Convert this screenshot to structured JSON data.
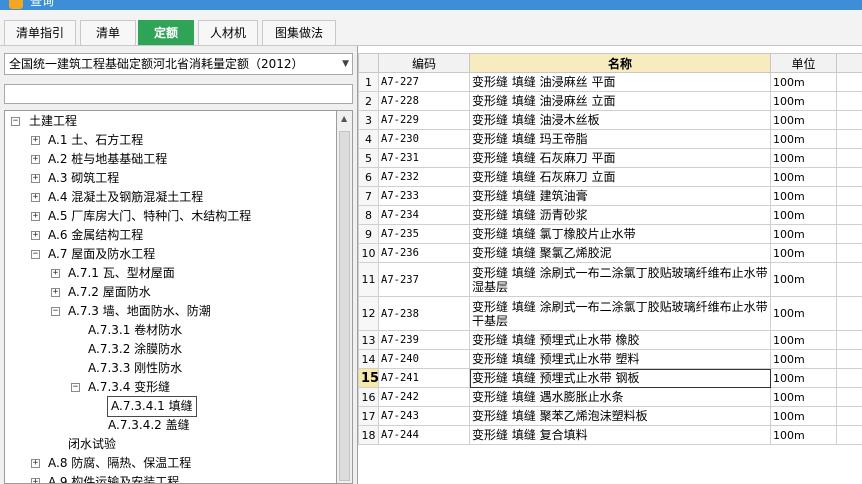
{
  "window": {
    "title": "查询"
  },
  "tabs": [
    {
      "label": "清单指引"
    },
    {
      "label": "清单"
    },
    {
      "label": "定额",
      "active": true
    },
    {
      "label": "人材机"
    },
    {
      "label": "图集做法"
    }
  ],
  "left": {
    "quota_library": "全国统一建筑工程基础定额河北省消耗量定额（2012）",
    "search_value": "",
    "tree": [
      {
        "label": "土建工程",
        "expand": "−"
      },
      {
        "label": "A.1 土、石方工程",
        "expand": "+"
      },
      {
        "label": "A.2 桩与地基基础工程",
        "expand": "+"
      },
      {
        "label": "A.3 砌筑工程",
        "expand": "+"
      },
      {
        "label": "A.4 混凝土及钢筋混凝土工程",
        "expand": "+"
      },
      {
        "label": "A.5 厂库房大门、特种门、木结构工程",
        "expand": "+"
      },
      {
        "label": "A.6 金属结构工程",
        "expand": "+"
      },
      {
        "label": "A.7 屋面及防水工程",
        "expand": "−"
      },
      {
        "label": "A.7.1 瓦、型材屋面",
        "expand": "+"
      },
      {
        "label": "A.7.2 屋面防水",
        "expand": "+"
      },
      {
        "label": "A.7.3 墙、地面防水、防潮",
        "expand": "−"
      },
      {
        "label": "A.7.3.1 卷材防水"
      },
      {
        "label": "A.7.3.2 涂膜防水"
      },
      {
        "label": "A.7.3.3 刚性防水"
      },
      {
        "label": "A.7.3.4 变形缝",
        "expand": "−"
      },
      {
        "label": "A.7.3.4.1 填缝",
        "selected": true
      },
      {
        "label": "A.7.3.4.2 盖缝"
      },
      {
        "label": "闭水试验"
      },
      {
        "label": "A.8 防腐、隔热、保温工程",
        "expand": "+"
      },
      {
        "label": "A.9 构件运输及安装工程",
        "expand": "+"
      }
    ]
  },
  "grid": {
    "columns": {
      "index": "",
      "code": "编码",
      "name": "名称",
      "unit": "单位"
    },
    "rows": [
      {
        "index": "1",
        "code": "A7-227",
        "name": "变形缝 填缝 油浸麻丝 平面",
        "unit": "100m"
      },
      {
        "index": "2",
        "code": "A7-228",
        "name": "变形缝 填缝 油浸麻丝 立面",
        "unit": "100m"
      },
      {
        "index": "3",
        "code": "A7-229",
        "name": "变形缝 填缝 油浸木丝板",
        "unit": "100m"
      },
      {
        "index": "4",
        "code": "A7-230",
        "name": "变形缝 填缝 玛王帝脂",
        "unit": "100m"
      },
      {
        "index": "5",
        "code": "A7-231",
        "name": "变形缝 填缝 石灰麻刀 平面",
        "unit": "100m"
      },
      {
        "index": "6",
        "code": "A7-232",
        "name": "变形缝 填缝 石灰麻刀 立面",
        "unit": "100m"
      },
      {
        "index": "7",
        "code": "A7-233",
        "name": "变形缝 填缝 建筑油膏",
        "unit": "100m"
      },
      {
        "index": "8",
        "code": "A7-234",
        "name": "变形缝 填缝 沥青砂浆",
        "unit": "100m"
      },
      {
        "index": "9",
        "code": "A7-235",
        "name": "变形缝 填缝 氯丁橡胶片止水带",
        "unit": "100m"
      },
      {
        "index": "10",
        "code": "A7-236",
        "name": "变形缝 填缝 聚氯乙烯胶泥",
        "unit": "100m"
      },
      {
        "index": "11",
        "code": "A7-237",
        "name": "变形缝 填缝 涂刷式一布二涂氯丁胶贴玻璃纤维布止水带 湿基层",
        "unit": "100m",
        "tall": true
      },
      {
        "index": "12",
        "code": "A7-238",
        "name": "变形缝 填缝 涂刷式一布二涂氯丁胶贴玻璃纤维布止水带 干基层",
        "unit": "100m",
        "tall": true
      },
      {
        "index": "13",
        "code": "A7-239",
        "name": "变形缝 填缝 预埋式止水带 橡胶",
        "unit": "100m"
      },
      {
        "index": "14",
        "code": "A7-240",
        "name": "变形缝 填缝 预埋式止水带 塑料",
        "unit": "100m"
      },
      {
        "index": "15",
        "code": "A7-241",
        "name": "变形缝 填缝 预埋式止水带 钢板",
        "unit": "100m",
        "current": true
      },
      {
        "index": "16",
        "code": "A7-242",
        "name": "变形缝 填缝 遇水膨胀止水条",
        "unit": "100m"
      },
      {
        "index": "17",
        "code": "A7-243",
        "name": "变形缝 填缝 聚苯乙烯泡沫塑料板",
        "unit": "100m"
      },
      {
        "index": "18",
        "code": "A7-244",
        "name": "变形缝 填缝 复合填料",
        "unit": "100m"
      }
    ]
  }
}
